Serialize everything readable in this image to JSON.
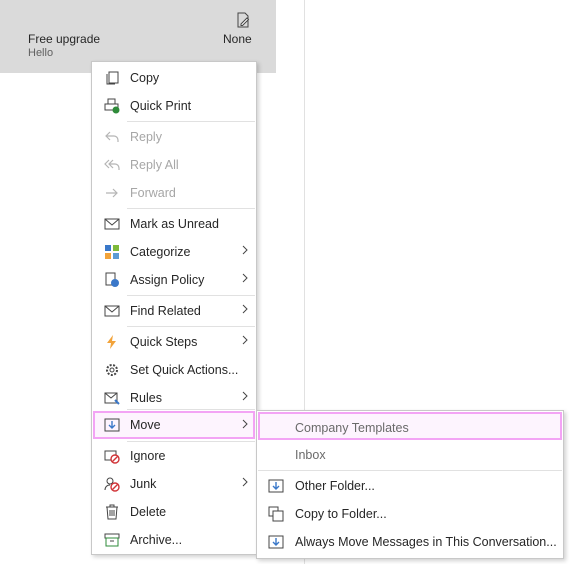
{
  "message": {
    "from": "Free upgrade",
    "preview": "Hello",
    "flag": "None"
  },
  "context_menu": [
    {
      "label": "Copy",
      "icon": "copy-icon",
      "disabled": false
    },
    {
      "label": "Quick Print",
      "icon": "quick-print-icon",
      "disabled": false
    },
    {
      "label": "Reply",
      "icon": "reply-icon",
      "disabled": true
    },
    {
      "label": "Reply All",
      "icon": "reply-all-icon",
      "disabled": true
    },
    {
      "label": "Forward",
      "icon": "forward-icon",
      "disabled": true
    },
    {
      "label": "Mark as Unread",
      "icon": "envelope-icon",
      "disabled": false
    },
    {
      "label": "Categorize",
      "icon": "categorize-icon",
      "disabled": false,
      "submenu": true
    },
    {
      "label": "Assign Policy",
      "icon": "assign-policy-icon",
      "disabled": false,
      "submenu": true
    },
    {
      "label": "Find Related",
      "icon": "find-related-icon",
      "disabled": false,
      "submenu": true
    },
    {
      "label": "Quick Steps",
      "icon": "lightning-icon",
      "disabled": false,
      "submenu": true
    },
    {
      "label": "Set Quick Actions...",
      "icon": "gear-icon",
      "disabled": false
    },
    {
      "label": "Rules",
      "icon": "rules-icon",
      "disabled": false,
      "submenu": true
    },
    {
      "label": "Move",
      "icon": "move-icon",
      "disabled": false,
      "submenu": true,
      "highlighted": true
    },
    {
      "label": "Ignore",
      "icon": "ignore-icon",
      "disabled": false
    },
    {
      "label": "Junk",
      "icon": "junk-icon",
      "disabled": false,
      "submenu": true
    },
    {
      "label": "Delete",
      "icon": "trash-icon",
      "disabled": false
    },
    {
      "label": "Archive...",
      "icon": "archive-icon",
      "disabled": false
    }
  ],
  "move_submenu": [
    {
      "label": "Company Templates",
      "highlighted": true
    },
    {
      "label": "Inbox"
    },
    {
      "label": "Other Folder...",
      "icon": "move-folder-icon"
    },
    {
      "label": "Copy to Folder...",
      "icon": "copy-folder-icon"
    },
    {
      "label": "Always Move Messages in This Conversation...",
      "icon": "always-move-icon"
    }
  ],
  "colors": {
    "highlight_border": "#f3a4f5",
    "selected_item_bg": "#dadada",
    "disabled_text": "#a6a6a6"
  }
}
